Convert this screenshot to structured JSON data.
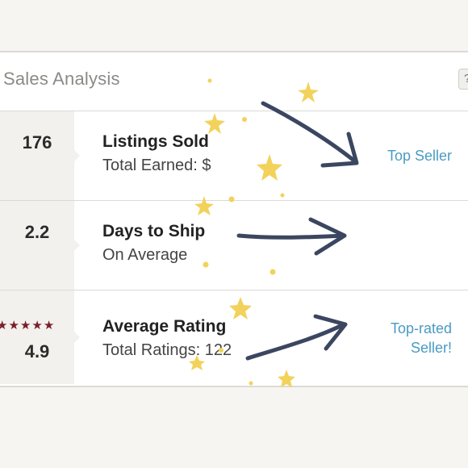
{
  "header": {
    "title": "Sales Analysis",
    "help_icon": "question-icon"
  },
  "rows": [
    {
      "value": "176",
      "title": "Listings Sold",
      "subtitle": "Total Earned: $",
      "badge": "Top Seller"
    },
    {
      "value": "2.2",
      "title": "Days to Ship",
      "subtitle": "On Average",
      "badge": ""
    },
    {
      "value": "4.9",
      "title": "Average Rating",
      "subtitle": "Total Ratings: 122",
      "badge_line1": "Top-rated",
      "badge_line2": "Seller!",
      "rating_stars": 5
    }
  ],
  "colors": {
    "accent": "#4a9bc2",
    "stars": "#7a1e2a",
    "doodle_arrow": "#3b4660",
    "doodle_star": "#f2d25a"
  }
}
